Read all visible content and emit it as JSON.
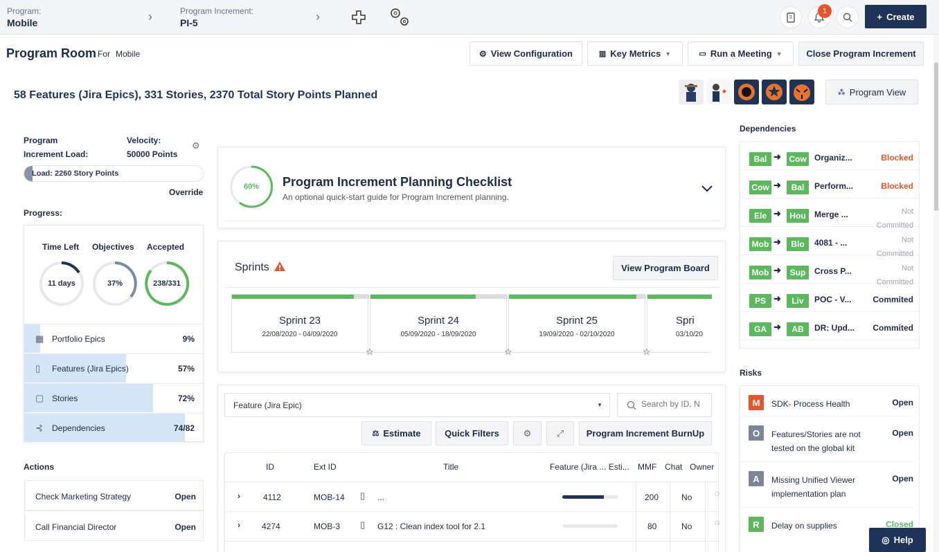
{
  "topbar": {
    "program_label": "Program:",
    "program_value": "Mobile",
    "pi_label": "Program Increment:",
    "pi_value": "PI-5",
    "create_label": "Create",
    "notif_count": "1"
  },
  "header": {
    "title": "Program Room",
    "for_label": "For",
    "for_value": "Mobile",
    "view_config": "View Configuration",
    "key_metrics": "Key Metrics",
    "run_meeting": "Run a Meeting",
    "close_pi": "Close Program Increment",
    "summary": "58 Features (Jira Epics), 331 Stories, 2370 Total Story Points Planned",
    "program_view": "Program View"
  },
  "load": {
    "label_line1": "Program",
    "label_line2": "Increment Load:",
    "velocity_label": "Velocity:",
    "velocity_value": "50000 Points",
    "bar_text": "Load: 2260 Story Points",
    "load_fraction": 0.045,
    "override": "Override"
  },
  "progress": {
    "title": "Progress:",
    "time_left_label": "Time Left",
    "objectives_label": "Objectives",
    "accepted_label": "Accepted",
    "time_left_value": "11 days",
    "objectives_value": "37%",
    "accepted_value": "238/331",
    "rows": [
      {
        "label": "Portfolio Epics",
        "value": "9%",
        "fill": 0.09
      },
      {
        "label": "Features (Jira Epics)",
        "value": "57%",
        "fill": 0.57
      },
      {
        "label": "Stories",
        "value": "72%",
        "fill": 0.72
      },
      {
        "label": "Dependencies",
        "value": "74/82",
        "fill": 0.9
      }
    ]
  },
  "actions": {
    "title": "Actions",
    "items": [
      {
        "label": "Check Marketing Strategy",
        "status": "Open"
      },
      {
        "label": "Call Financial Director",
        "status": "Open"
      }
    ]
  },
  "checklist": {
    "percent": "60%",
    "title": "Program Increment Planning Checklist",
    "subtitle": "An optional quick-start guide for Program Increment planning."
  },
  "sprints": {
    "title": "Sprints",
    "view_board": "View Program Board",
    "items": [
      {
        "name": "Sprint 23",
        "dates": "22/08/2020 - 04/09/2020"
      },
      {
        "name": "Sprint 24",
        "dates": "05/09/2020 - 18/09/2020"
      },
      {
        "name": "Sprint 25",
        "dates": "19/09/2020 - 02/10/2020"
      },
      {
        "name": "Spri",
        "dates": "03/10/20"
      }
    ]
  },
  "features": {
    "select_value": "Feature (Jira Epic)",
    "search_placeholder": "Search by ID, N",
    "estimate": "Estimate",
    "quick_filters": "Quick Filters",
    "burnup": "Program Increment BurnUp",
    "columns": {
      "id": "ID",
      "ext_id": "Ext ID",
      "title": "Title",
      "estimate": "Feature (Jira ... Esti...",
      "mmf": "MMF",
      "chat": "Chat",
      "owner": "Owner"
    },
    "rows": [
      {
        "id": "4112",
        "ext_id": "MOB-14",
        "title": "...",
        "progress": 0.75,
        "mmf": "200",
        "chat": "No"
      },
      {
        "id": "4274",
        "ext_id": "MOB-3",
        "title": "G12 : Clean index tool for 2.1",
        "progress": 0,
        "mmf": "80",
        "chat": "No"
      }
    ]
  },
  "dependencies": {
    "title": "Dependencies",
    "items": [
      {
        "from": "Bal",
        "to": "Cow",
        "title": "Organiz...",
        "status": "Blocked",
        "status_color": "#e8552a"
      },
      {
        "from": "Cow",
        "to": "Bal",
        "title": "Perform...",
        "status": "Blocked",
        "status_color": "#e8552a"
      },
      {
        "from": "Ele",
        "to": "Hou",
        "title": "Merge ...",
        "status": "Not Committed",
        "status_color": "#a0a4ad"
      },
      {
        "from": "Mob",
        "to": "Blo",
        "title": "4081 - ...",
        "status": "Not Committed",
        "status_color": "#a0a4ad"
      },
      {
        "from": "Mob",
        "to": "Sup",
        "title": "Cross P...",
        "status": "Not Committed",
        "status_color": "#a0a4ad"
      },
      {
        "from": "PS",
        "to": "Liv",
        "title": "POC - V...",
        "status": "Commited",
        "status_color": "#1f2a44"
      },
      {
        "from": "GA",
        "to": "AB",
        "title": "DR: Upd...",
        "status": "Commited",
        "status_color": "#1f2a44"
      }
    ]
  },
  "risks": {
    "title": "Risks",
    "items": [
      {
        "letter": "M",
        "color": "#e8552a",
        "title": "SDK- Process Health",
        "status": "Open"
      },
      {
        "letter": "O",
        "color": "#7d8699",
        "title": "Features/Stories are not tested on the global kit",
        "status": "Open"
      },
      {
        "letter": "A",
        "color": "#7d8699",
        "title": "Missing Unified Viewer implementation plan",
        "status": "Open"
      },
      {
        "letter": "R",
        "color": "#5cb85c",
        "title": "Delay on supplies",
        "status": "Closed"
      }
    ]
  },
  "help": {
    "label": "Help"
  }
}
